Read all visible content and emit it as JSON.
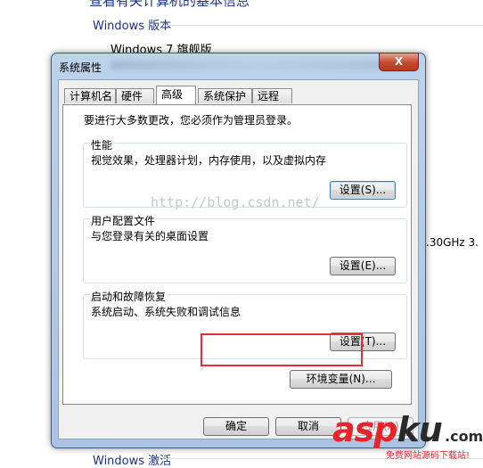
{
  "background": {
    "top_text": "查看有关计算机的基本信息",
    "section_windows_edition": "Windows 版本",
    "edition_value": "Windows 7 旗舰版",
    "cpu_fragment": ".30GHz   3.",
    "section_activation": "Windows 激活"
  },
  "dialog": {
    "title": "系统属性",
    "close_glyph": "X",
    "tabs": [
      {
        "label": "计算机名"
      },
      {
        "label": "硬件"
      },
      {
        "label": "高级",
        "active": true
      },
      {
        "label": "系统保护"
      },
      {
        "label": "远程"
      }
    ],
    "admin_note": "要进行大多数更改，您必须作为管理员登录。",
    "groups": {
      "performance": {
        "title": "性能",
        "desc": "视觉效果，处理器计划，内存使用，以及虚拟内存",
        "button": "设置(S)..."
      },
      "user_profiles": {
        "title": "用户配置文件",
        "desc": "与您登录有关的桌面设置",
        "button": "设置(E)..."
      },
      "startup_recovery": {
        "title": "启动和故障恢复",
        "desc": "系统启动、系统失败和调试信息",
        "button": "设置(T)..."
      }
    },
    "env_button": "环境变量(N)...",
    "ok_button": "确定",
    "cancel_button": "取消",
    "apply_button": "应用(A)",
    "watermark": "http://blog.csdn.net/"
  },
  "logo": {
    "text_red": "asp",
    "text_dark": "ku",
    "suffix": ".com",
    "tagline": "免费网站源码下载站!"
  },
  "colors": {
    "highlight_box": "#e03030",
    "close_button": "#c8462e",
    "logo_red": "#e8232a"
  }
}
